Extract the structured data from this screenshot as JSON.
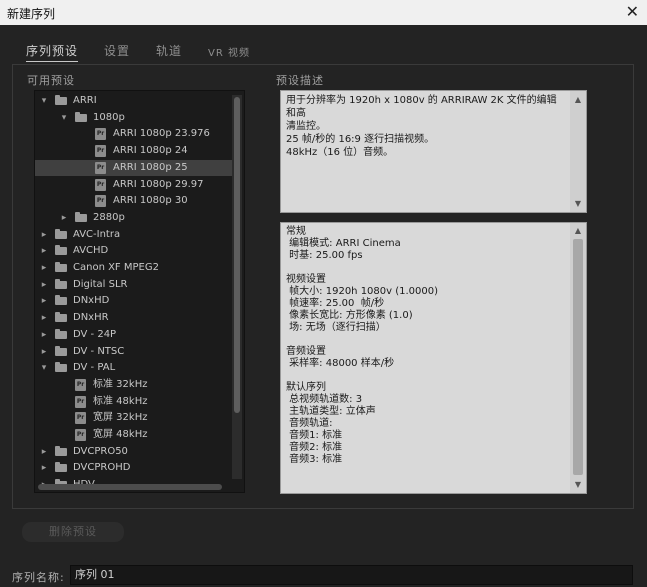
{
  "window": {
    "title": "新建序列",
    "close_glyph": "✕"
  },
  "tabs": [
    {
      "label": "序列预设"
    },
    {
      "label": "设置"
    },
    {
      "label": "轨道"
    },
    {
      "label": "VR 视频"
    }
  ],
  "available_presets_label": "可用预设",
  "preset_description_label": "预设描述",
  "tree": [
    {
      "label": "ARRI",
      "depth": 0,
      "type": "folder",
      "expanded": true,
      "selected": false
    },
    {
      "label": "1080p",
      "depth": 1,
      "type": "folder",
      "expanded": true,
      "selected": false
    },
    {
      "label": "ARRI 1080p 23.976",
      "depth": 2,
      "type": "preset",
      "selected": false
    },
    {
      "label": "ARRI 1080p 24",
      "depth": 2,
      "type": "preset",
      "selected": false
    },
    {
      "label": "ARRI 1080p 25",
      "depth": 2,
      "type": "preset",
      "selected": true
    },
    {
      "label": "ARRI 1080p 29.97",
      "depth": 2,
      "type": "preset",
      "selected": false
    },
    {
      "label": "ARRI 1080p 30",
      "depth": 2,
      "type": "preset",
      "selected": false
    },
    {
      "label": "2880p",
      "depth": 1,
      "type": "folder",
      "expanded": false,
      "selected": false
    },
    {
      "label": "AVC-Intra",
      "depth": 0,
      "type": "folder",
      "expanded": false,
      "selected": false
    },
    {
      "label": "AVCHD",
      "depth": 0,
      "type": "folder",
      "expanded": false,
      "selected": false
    },
    {
      "label": "Canon XF MPEG2",
      "depth": 0,
      "type": "folder",
      "expanded": false,
      "selected": false
    },
    {
      "label": "Digital SLR",
      "depth": 0,
      "type": "folder",
      "expanded": false,
      "selected": false
    },
    {
      "label": "DNxHD",
      "depth": 0,
      "type": "folder",
      "expanded": false,
      "selected": false
    },
    {
      "label": "DNxHR",
      "depth": 0,
      "type": "folder",
      "expanded": false,
      "selected": false
    },
    {
      "label": "DV - 24P",
      "depth": 0,
      "type": "folder",
      "expanded": false,
      "selected": false
    },
    {
      "label": "DV - NTSC",
      "depth": 0,
      "type": "folder",
      "expanded": false,
      "selected": false
    },
    {
      "label": "DV - PAL",
      "depth": 0,
      "type": "folder",
      "expanded": true,
      "selected": false
    },
    {
      "label": "标准 32kHz",
      "depth": 1,
      "type": "preset",
      "selected": false
    },
    {
      "label": "标准 48kHz",
      "depth": 1,
      "type": "preset",
      "selected": false
    },
    {
      "label": "宽屏 32kHz",
      "depth": 1,
      "type": "preset",
      "selected": false
    },
    {
      "label": "宽屏 48kHz",
      "depth": 1,
      "type": "preset",
      "selected": false
    },
    {
      "label": "DVCPRO50",
      "depth": 0,
      "type": "folder",
      "expanded": false,
      "selected": false
    },
    {
      "label": "DVCPROHD",
      "depth": 0,
      "type": "folder",
      "expanded": false,
      "selected": false
    },
    {
      "label": "HDV",
      "depth": 0,
      "type": "folder",
      "expanded": false,
      "selected": false
    }
  ],
  "preset_icon_text": "Pr",
  "description_lines": [
    "用于分辨率为 1920h x 1080v 的 ARRIRAW 2K 文件的编辑和高",
    "清监控。",
    "25 帧/秒的 16:9 逐行扫描视频。",
    "48kHz（16 位）音频。"
  ],
  "info_lines": [
    "常规",
    " 编辑模式: ARRI Cinema",
    " 时基: 25.00 fps",
    "",
    "视频设置",
    " 帧大小: 1920h 1080v (1.0000)",
    " 帧速率: 25.00  帧/秒",
    " 像素长宽比: 方形像素 (1.0)",
    " 场: 无场（逐行扫描）",
    "",
    "音频设置",
    " 采样率: 48000 样本/秒",
    "",
    "默认序列",
    " 总视频轨道数: 3",
    " 主轨道类型: 立体声",
    " 音频轨道:",
    " 音频1: 标准",
    " 音频2: 标准",
    " 音频3: 标准"
  ],
  "delete_button_label": "删除预设",
  "sequence_name": {
    "label": "序列名称:",
    "value": "序列 01"
  },
  "colors": {
    "background": "#232323",
    "panel": "#1b1b1b",
    "selected_row": "#404040",
    "text_box": "#d9d9d9"
  }
}
